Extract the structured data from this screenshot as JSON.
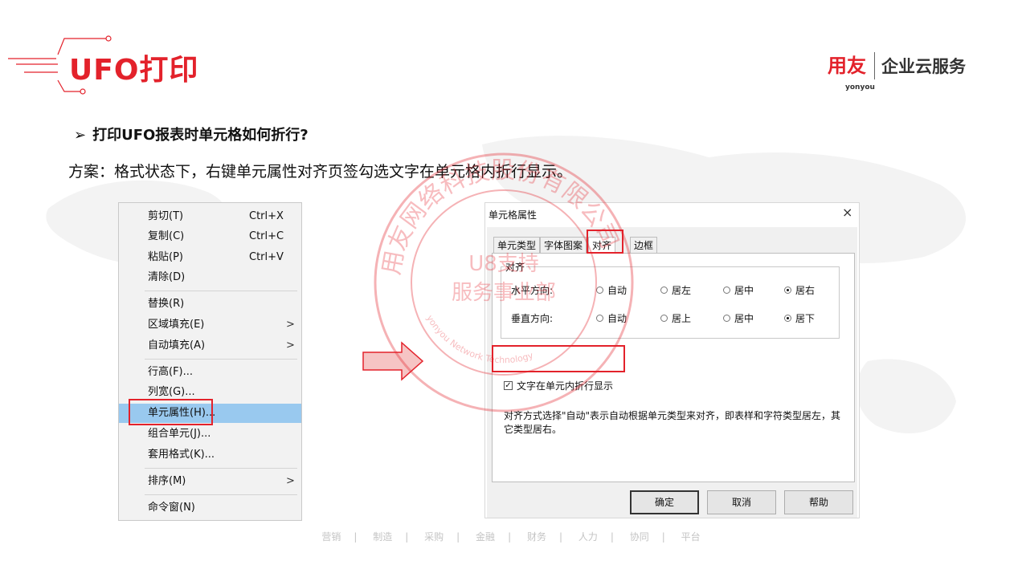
{
  "slide": {
    "title": "UFO打印",
    "question": "打印UFO报表时单元格如何折行?",
    "question_marker": "➢",
    "solution": "方案：格式状态下，右键单元属性对齐页签勾选文字在单元格内折行显示。"
  },
  "logo": {
    "mark": "用友",
    "sub": "yonyou",
    "text": "企业云服务"
  },
  "context_menu": {
    "items": [
      {
        "label": "剪切(T)",
        "shortcut": "Ctrl+X",
        "submenu": ""
      },
      {
        "label": "复制(C)",
        "shortcut": "Ctrl+C",
        "submenu": ""
      },
      {
        "label": "粘贴(P)",
        "shortcut": "Ctrl+V",
        "submenu": ""
      },
      {
        "label": "清除(D)",
        "shortcut": "",
        "submenu": ""
      },
      {
        "label": "替换(R)",
        "shortcut": "",
        "submenu": ""
      },
      {
        "label": "区域填充(E)",
        "shortcut": "",
        "submenu": ">"
      },
      {
        "label": "自动填充(A)",
        "shortcut": "",
        "submenu": ">"
      },
      {
        "label": "行高(F)...",
        "shortcut": "",
        "submenu": ""
      },
      {
        "label": "列宽(G)...",
        "shortcut": "",
        "submenu": ""
      },
      {
        "label": "单元属性(H)...",
        "shortcut": "",
        "submenu": ""
      },
      {
        "label": "组合单元(J)...",
        "shortcut": "",
        "submenu": ""
      },
      {
        "label": "套用格式(K)...",
        "shortcut": "",
        "submenu": ""
      },
      {
        "label": "排序(M)",
        "shortcut": "",
        "submenu": ">"
      },
      {
        "label": "命令窗(N)",
        "shortcut": "",
        "submenu": ""
      }
    ]
  },
  "dialog": {
    "title": "单元格属性",
    "close": "×",
    "tabs": [
      "单元类型",
      "字体图案",
      "对齐",
      "边框"
    ],
    "group_label": "对齐",
    "horizontal_label": "水平方向:",
    "vertical_label": "垂直方向:",
    "horizontal_options": [
      "自动",
      "居左",
      "居中",
      "居右"
    ],
    "horizontal_selected": "居右",
    "vertical_options": [
      "自动",
      "居上",
      "居中",
      "居下"
    ],
    "vertical_selected": "居下",
    "wrap_label": "文字在单元内折行显示",
    "wrap_checked": true,
    "note": "对齐方式选择\"自动\"表示自动根据单元类型来对齐，即表样和字符类型居左，其它类型居右。",
    "buttons": {
      "ok": "确定",
      "cancel": "取消",
      "help": "帮助"
    }
  },
  "stamp": {
    "ring_text": "用友网络科技股份有限公司",
    "center_line1": "U8支持",
    "center_line2": "服务事业部",
    "bottom_text": "yonyou Network Technology"
  },
  "footer": {
    "items": [
      "营销",
      "制造",
      "采购",
      "金融",
      "财务",
      "人力",
      "协同",
      "平台"
    ]
  },
  "colors": {
    "brand_red": "#e3222b",
    "highlight_blue": "#99c9ef"
  }
}
